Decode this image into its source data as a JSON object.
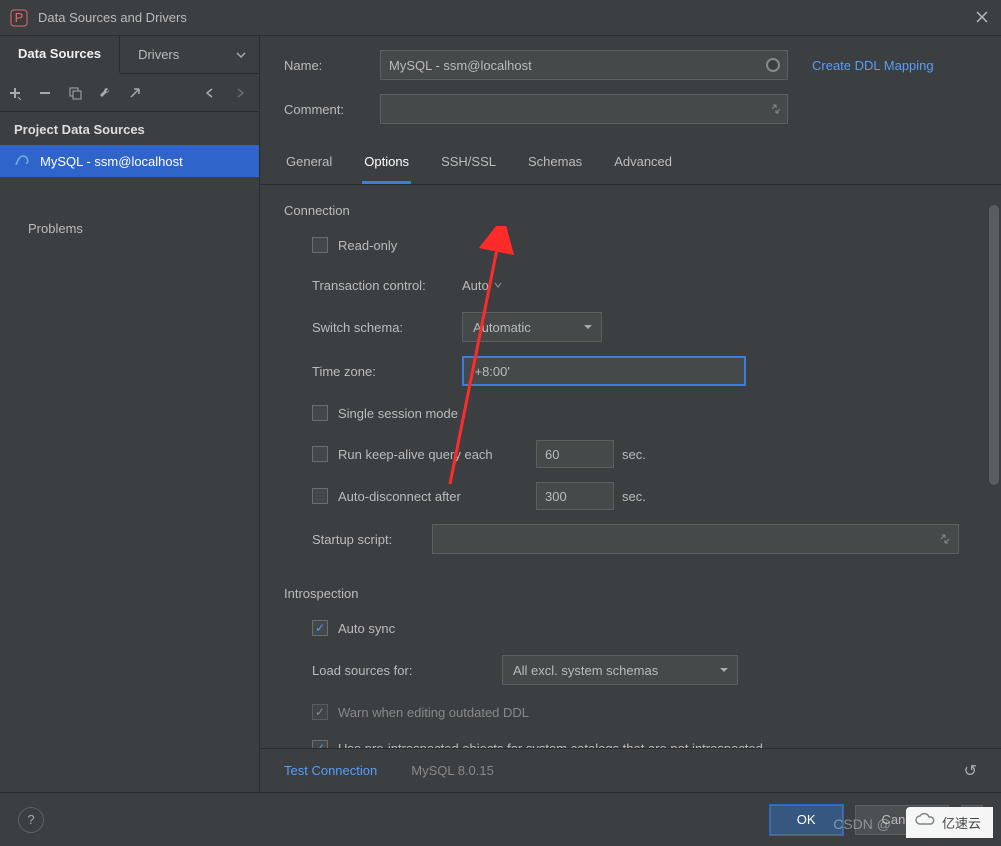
{
  "window": {
    "title": "Data Sources and Drivers"
  },
  "leftTabs": {
    "dataSources": "Data Sources",
    "drivers": "Drivers"
  },
  "toolbarIcons": {
    "add": "add-icon",
    "remove": "remove-icon",
    "copy": "copy-icon",
    "wrench": "wrench-icon",
    "goto": "goto-icon",
    "back": "back-icon",
    "forward": "forward-icon"
  },
  "leftPanel": {
    "sectionHeader": "Project Data Sources",
    "dataSource": "MySQL - ssm@localhost",
    "problems": "Problems"
  },
  "form": {
    "nameLabel": "Name:",
    "nameValue": "MySQL - ssm@localhost",
    "commentLabel": "Comment:",
    "commentValue": "",
    "ddlLink": "Create DDL Mapping"
  },
  "tabs": {
    "general": "General",
    "options": "Options",
    "sshssl": "SSH/SSL",
    "schemas": "Schemas",
    "advanced": "Advanced"
  },
  "connection": {
    "header": "Connection",
    "readOnly": "Read-only",
    "transactionLabel": "Transaction control:",
    "transactionValue": "Auto",
    "switchSchemaLabel": "Switch schema:",
    "switchSchemaValue": "Automatic",
    "timeZoneLabel": "Time zone:",
    "timeZoneValue": "'+8:00'",
    "singleSession": "Single session mode",
    "keepAlive": "Run keep-alive query each",
    "keepAliveValue": "60",
    "autoDisconnect": "Auto-disconnect after",
    "autoDisconnectValue": "300",
    "secUnit": "sec.",
    "startupLabel": "Startup script:",
    "startupValue": ""
  },
  "introspection": {
    "header": "Introspection",
    "autoSync": "Auto sync",
    "loadSourcesLabel": "Load sources for:",
    "loadSourcesValue": "All excl. system schemas",
    "warnDDL": "Warn when editing outdated DDL",
    "usePreIntro": "Use pre-introspected objects for system catalogs that are not introspected"
  },
  "footer": {
    "testConnection": "Test Connection",
    "driverVersion": "MySQL 8.0.15"
  },
  "buttons": {
    "ok": "OK",
    "cancel": "Cancel"
  },
  "watermark": {
    "csdn": "CSDN @",
    "ysy": "亿速云"
  }
}
